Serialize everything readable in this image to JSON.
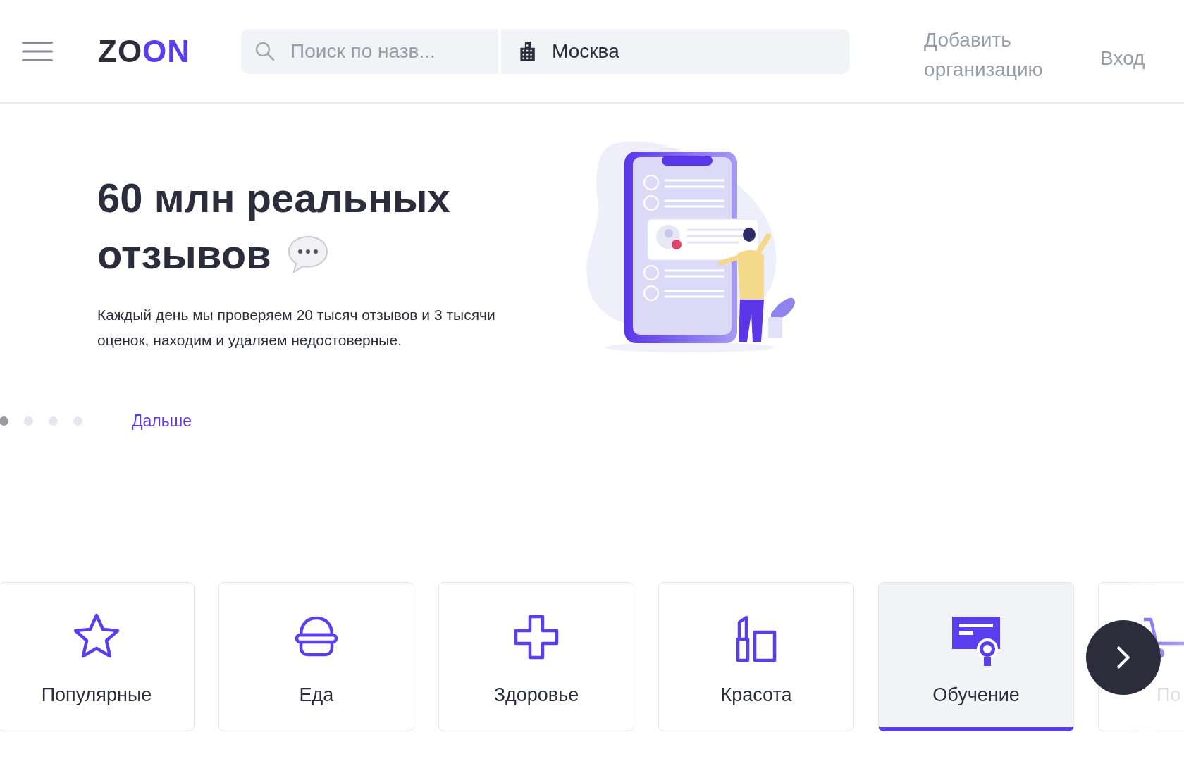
{
  "header": {
    "logo": "ZOON",
    "search": {
      "placeholder": "Поиск по назв..."
    },
    "city": {
      "value": "Москва"
    },
    "add_business": "Добавить организацию",
    "login": "Вход"
  },
  "hero": {
    "headline": [
      "60 млн реальных",
      "отзывов"
    ],
    "description": "Каждый день мы проверяем 20 тысяч отзывов и 3 тысячи оценок, находим и удаляем недостоверные.",
    "slides": [
      {
        "selected": true
      },
      {
        "selected": false
      },
      {
        "selected": false
      },
      {
        "selected": false
      }
    ],
    "next": "Дальше"
  },
  "categories": [
    {
      "label": "Популярные",
      "selected": false,
      "kind": "full"
    },
    {
      "label": "Еда",
      "selected": false,
      "kind": "full"
    },
    {
      "label": "Здоровье",
      "selected": false,
      "kind": "full"
    },
    {
      "label": "Красота",
      "selected": false,
      "kind": "full"
    },
    {
      "label": "Обучение",
      "selected": true,
      "kind": "full"
    },
    {
      "label": "По",
      "selected": false,
      "kind": "partial"
    }
  ]
}
